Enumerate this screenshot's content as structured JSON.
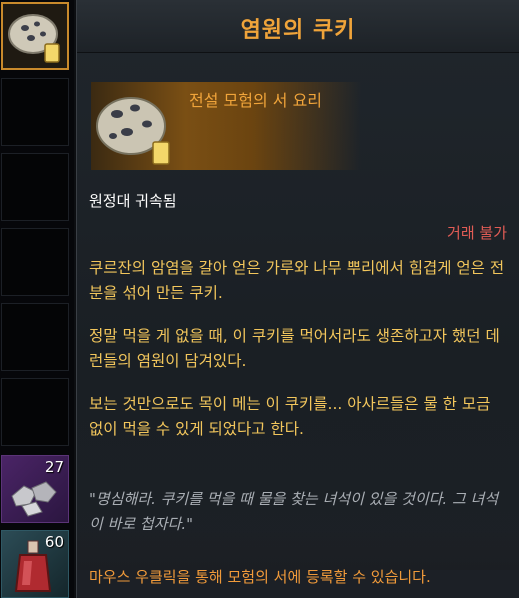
{
  "inventory": {
    "slots": [
      {
        "type": "item",
        "icon": "cookie-icon",
        "selected": true
      },
      {
        "type": "empty"
      },
      {
        "type": "empty"
      },
      {
        "type": "empty"
      },
      {
        "type": "empty"
      },
      {
        "type": "empty"
      },
      {
        "type": "item",
        "icon": "ore-stones-icon",
        "count": "27"
      },
      {
        "type": "item",
        "icon": "potion-bottle-icon",
        "count": "60"
      }
    ]
  },
  "tooltip": {
    "title": "염원의 쿠키",
    "grade": "전설 모험의 서 요리",
    "binding": "원정대 귀속됨",
    "trade_status": "거래 불가",
    "description": [
      "쿠르잔의 암염을 갈아 얻은 가루와 나무 뿌리에서 힘겹게 얻은 전분을 섞어 만든 쿠키.",
      "정말 먹을 게 없을 때, 이 쿠키를 먹어서라도 생존하고자 했던 데런들의 염원이 담겨있다.",
      "보는 것만으로도 목이 메는 이 쿠키를... 아사르들은 물 한 모금 없이 먹을 수 있게 되었다고 한다."
    ],
    "flavor": "\"명심해라. 쿠키를 먹을 때 물을 찾는 녀석이 있을 것이다. 그 녀석이 바로 첩자다.\"",
    "hint": "마우스 우클릭을 통해 모험의 서에 등록할 수 있습니다."
  },
  "colors": {
    "title": "#f0a43a",
    "description": "#f2c65c",
    "untradable": "#e05c55",
    "flavor": "#a9aeb4",
    "hint": "#f09a3a",
    "selected_border": "#c98a2c"
  }
}
